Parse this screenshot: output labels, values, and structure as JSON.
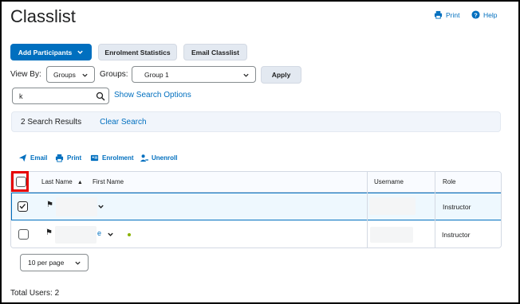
{
  "page": {
    "title": "Classlist"
  },
  "header_links": {
    "print": "Print",
    "help": "Help"
  },
  "toolbar": {
    "add_participants": "Add Participants",
    "enrolment_statistics": "Enrolment Statistics",
    "email_classlist": "Email Classlist"
  },
  "filters": {
    "view_by_label": "View By:",
    "view_by_value": "Groups",
    "groups_label": "Groups:",
    "groups_value": "Group 1",
    "apply": "Apply"
  },
  "search": {
    "value": "k",
    "show_options": "Show Search Options"
  },
  "results": {
    "count": "2 Search Results",
    "clear": "Clear Search"
  },
  "actions": {
    "email": "Email",
    "print": "Print",
    "enrolment": "Enrolment",
    "unenroll": "Unenroll"
  },
  "table": {
    "columns": {
      "last_name": "Last Name",
      "first_name": "First Name",
      "username": "Username",
      "role": "Role"
    },
    "rows": [
      {
        "selected": true,
        "name_suffix": "",
        "role": "Instructor"
      },
      {
        "selected": false,
        "name_suffix": "e",
        "role": "Instructor"
      }
    ]
  },
  "pagination": {
    "per_page": "10 per page"
  },
  "footer": {
    "total_users": "Total Users: 2"
  },
  "colors": {
    "accent": "#006fbf",
    "highlight_border": "#e60000",
    "selected_row": "#eef8fe"
  }
}
